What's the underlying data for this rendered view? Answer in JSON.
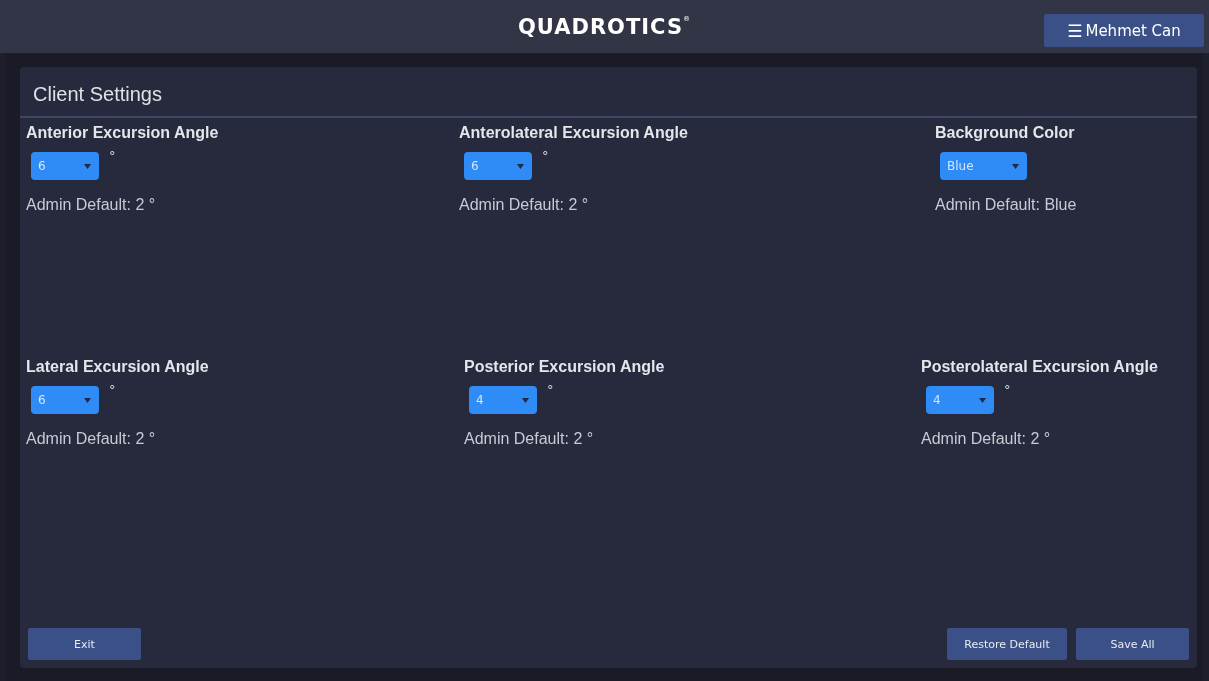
{
  "header": {
    "logo": "QUADROTICS",
    "logo_mark": "®",
    "menu_icon": "☰",
    "user": "Mehmet Can"
  },
  "panel": {
    "title": "Client Settings"
  },
  "settings": [
    [
      {
        "label": "Anterior Excursion Angle",
        "value": "6",
        "unit": "°",
        "default": "Admin Default: 2 °"
      },
      {
        "label": "Anterolateral Excursion Angle",
        "value": "6",
        "unit": "°",
        "default": "Admin Default: 2 °"
      },
      {
        "label": "Background Color",
        "value": "Blue",
        "default": "Admin Default: Blue"
      }
    ],
    [
      {
        "label": "Lateral Excursion Angle",
        "value": "6",
        "unit": "°",
        "default": "Admin Default: 2 °"
      },
      {
        "label": "Posterior Excursion Angle",
        "value": "4",
        "unit": "°",
        "default": "Admin Default: 2 °"
      },
      {
        "label": "Posterolateral Excursion Angle",
        "value": "4",
        "unit": "°",
        "default": "Admin Default: 2 °"
      }
    ]
  ],
  "buttons_left": [
    "Exit"
  ],
  "buttons_right": [
    "Restore Default",
    "Save All"
  ]
}
